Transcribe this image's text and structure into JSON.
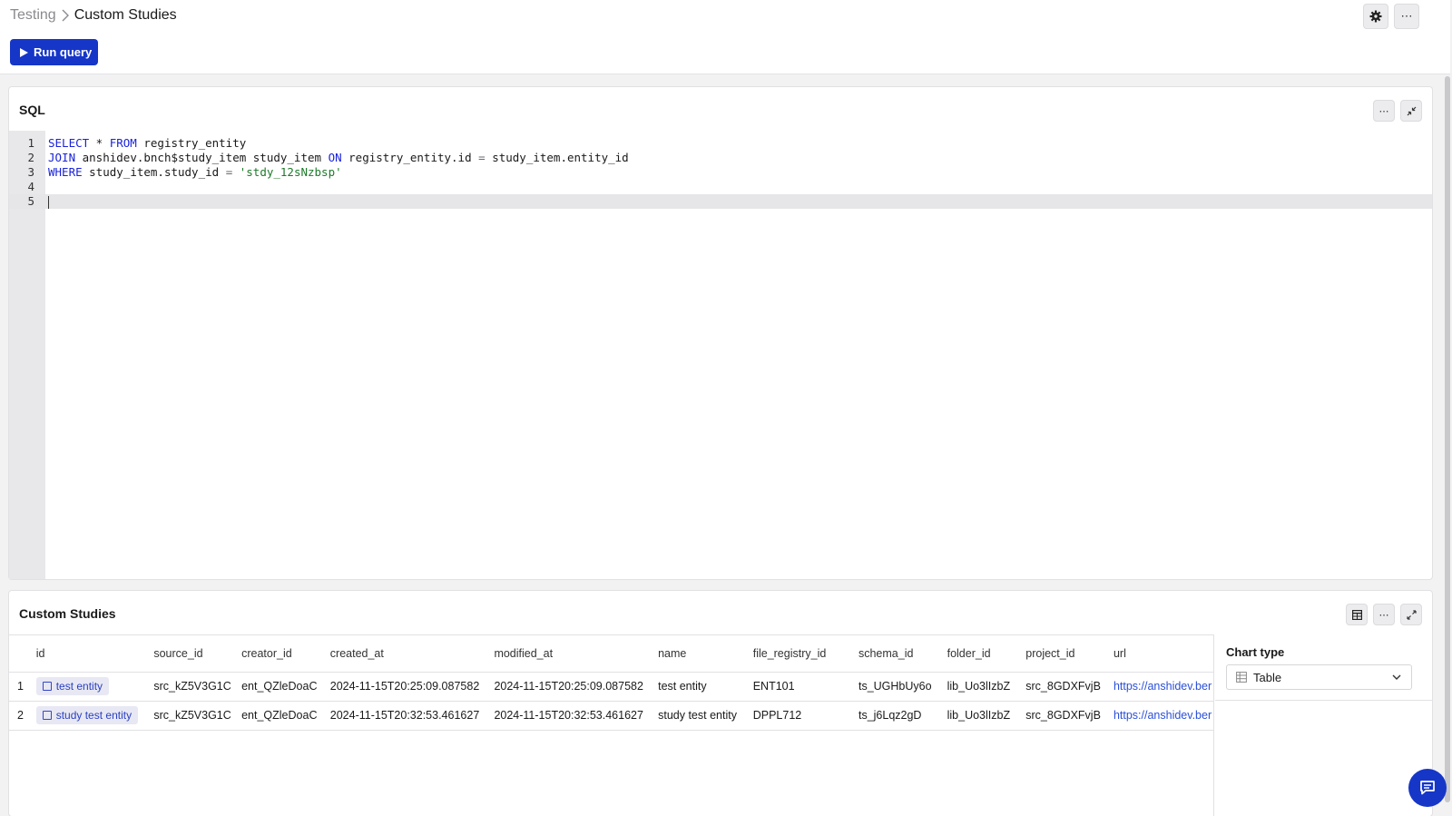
{
  "breadcrumb": {
    "parent": "Testing",
    "current": "Custom Studies"
  },
  "toolbar": {
    "run_label": "Run query",
    "settings_icon": "gear-icon",
    "more_icon": "more-icon"
  },
  "sql_panel": {
    "title": "SQL",
    "line_numbers": [
      "1",
      "2",
      "3",
      "4",
      "5"
    ],
    "lines": [
      [
        {
          "t": "SELECT",
          "c": "kw"
        },
        {
          "t": " * ",
          "c": ""
        },
        {
          "t": "FROM",
          "c": "kw"
        },
        {
          "t": " registry_entity",
          "c": ""
        }
      ],
      [
        {
          "t": "JOIN",
          "c": "kw"
        },
        {
          "t": " anshidev.bnch$study_item study_item ",
          "c": ""
        },
        {
          "t": "ON",
          "c": "kw"
        },
        {
          "t": " registry_entity.id ",
          "c": ""
        },
        {
          "t": "=",
          "c": "op"
        },
        {
          "t": " study_item.entity_id",
          "c": ""
        }
      ],
      [
        {
          "t": "WHERE",
          "c": "kw"
        },
        {
          "t": " study_item.study_id ",
          "c": ""
        },
        {
          "t": "=",
          "c": "op"
        },
        {
          "t": " ",
          "c": ""
        },
        {
          "t": "'stdy_12sNzbsp'",
          "c": "str"
        }
      ],
      [],
      []
    ],
    "active_line": 5
  },
  "results_panel": {
    "title": "Custom Studies",
    "columns": [
      "id",
      "source_id",
      "creator_id",
      "created_at",
      "modified_at",
      "name",
      "file_registry_id",
      "schema_id",
      "folder_id",
      "project_id",
      "url"
    ],
    "rows": [
      {
        "num": "1",
        "id": "test entity",
        "source_id": "src_kZ5V3G1C",
        "creator_id": "ent_QZleDoaC",
        "created_at": "2024-11-15T20:25:09.087582",
        "modified_at": "2024-11-15T20:25:09.087582",
        "name": "test entity",
        "file_registry_id": "ENT101",
        "schema_id": "ts_UGHbUy6o",
        "folder_id": "lib_Uo3lIzbZ",
        "project_id": "src_8GDXFvjB",
        "url": "https://anshidev.ber"
      },
      {
        "num": "2",
        "id": "study test entity",
        "source_id": "src_kZ5V3G1C",
        "creator_id": "ent_QZleDoaC",
        "created_at": "2024-11-15T20:32:53.461627",
        "modified_at": "2024-11-15T20:32:53.461627",
        "name": "study test entity",
        "file_registry_id": "DPPL712",
        "schema_id": "ts_j6Lqz2gD",
        "folder_id": "lib_Uo3lIzbZ",
        "project_id": "src_8GDXFvjB",
        "url": "https://anshidev.ber"
      }
    ],
    "chart_type_label": "Chart type",
    "chart_type_value": "Table"
  },
  "colors": {
    "accent": "#1636c8",
    "keyword": "#1a23d8",
    "string": "#1d7a2a",
    "link": "#2b4fd8"
  }
}
